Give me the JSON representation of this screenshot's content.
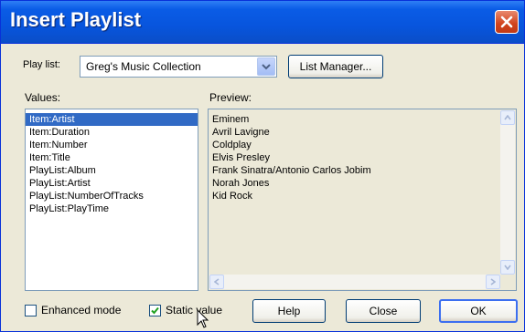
{
  "dialog": {
    "title": "Insert Playlist",
    "playlist_label": "Play list:",
    "playlist_value": "Greg's Music Collection",
    "list_manager_label": "List Manager...",
    "values_label": "Values:",
    "preview_label": "Preview:",
    "values": [
      "Item:Artist",
      "Item:Duration",
      "Item:Number",
      "Item:Title",
      "PlayList:Album",
      "PlayList:Artist",
      "PlayList:NumberOfTracks",
      "PlayList:PlayTime"
    ],
    "selected_value_index": 0,
    "preview": [
      "Eminem",
      "Avril Lavigne",
      "Coldplay",
      "Elvis Presley",
      "Frank Sinatra/Antonio Carlos Jobim",
      "Norah Jones",
      "Kid Rock"
    ],
    "enhanced_mode_label": "Enhanced mode",
    "enhanced_mode_checked": false,
    "static_value_label": "Static value",
    "static_value_checked": true,
    "help_label": "Help",
    "close_label": "Close",
    "ok_label": "OK"
  },
  "colors": {
    "titlebar": "#0855dd",
    "dialog_bg": "#ece9d8",
    "selection": "#316ac5",
    "close_button": "#d1431c"
  },
  "icons": [
    "close-icon",
    "chevron-down-icon",
    "scroll-up-icon",
    "scroll-down-icon",
    "scroll-left-icon",
    "scroll-right-icon",
    "check-icon",
    "mouse-cursor-icon"
  ]
}
